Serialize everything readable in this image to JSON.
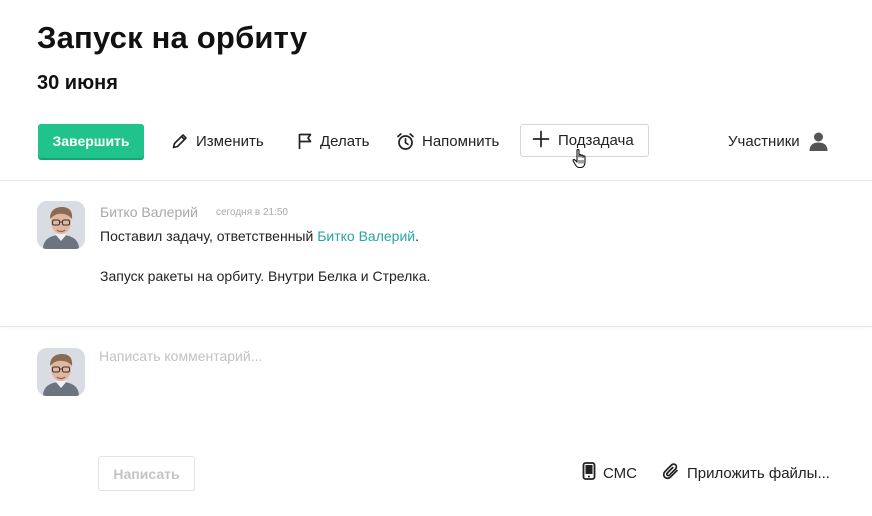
{
  "task": {
    "title": "Запуск на орбиту",
    "date": "30 июня"
  },
  "toolbar": {
    "finish_label": "Завершить",
    "edit_label": "Изменить",
    "do_label": "Делать",
    "remind_label": "Напомнить",
    "subtask_label": "Подзадача",
    "members_label": "Участники"
  },
  "post": {
    "author": "Битко Валерий",
    "time": "сегодня в 21:50",
    "text_prefix": "Поставил задачу, ответственный ",
    "assignee_link": "Битко Валерий",
    "text_suffix": ".",
    "description": "Запуск ракеты на орбиту. Внутри Белка и Стрелка."
  },
  "compose": {
    "placeholder": "Написать комментарий...",
    "send_label": "Написать",
    "sms_label": "СМС",
    "attach_label": "Приложить файлы..."
  },
  "colors": {
    "accent_green": "#21c38d",
    "link_teal": "#2aa4a6",
    "muted_text": "#a9a9a9"
  },
  "icons": {
    "edit": "pencil-icon",
    "do": "flag-icon",
    "remind": "alarm-clock-icon",
    "subtask": "plus-icon",
    "members": "user-icon",
    "sms": "phone-icon",
    "attach": "paperclip-icon",
    "cursor": "hand-pointer-icon"
  }
}
